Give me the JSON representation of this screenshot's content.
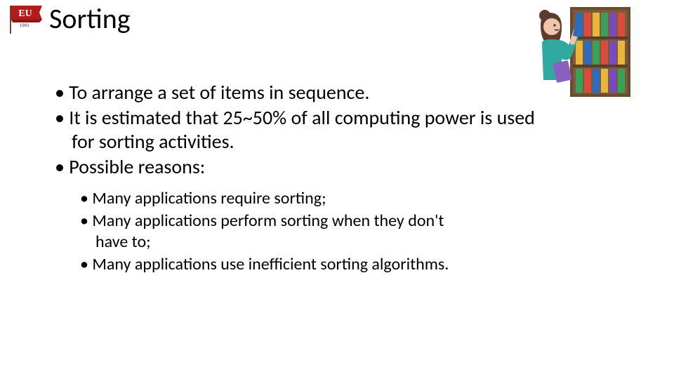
{
  "title": "Sorting",
  "bullets": {
    "b1": "To arrange a set of items in sequence.",
    "b2": "It is estimated that 25~50% of all computing power is used for sorting activities.",
    "b3": "Possible reasons:"
  },
  "subbullets": {
    "s1": "Many applications require sorting;",
    "s2": "Many applications perform sorting when they don't have to;",
    "s3": "Many applications use inefficient sorting algorithms."
  },
  "logo": {
    "text": "EU",
    "year": "1863"
  },
  "colors": {
    "flag": "#b31b1b",
    "book_red": "#a13a3a",
    "shelf_brown": "#6b4a2d",
    "person_hair": "#5b3b2e",
    "person_shirt": "#2fa9a0"
  }
}
